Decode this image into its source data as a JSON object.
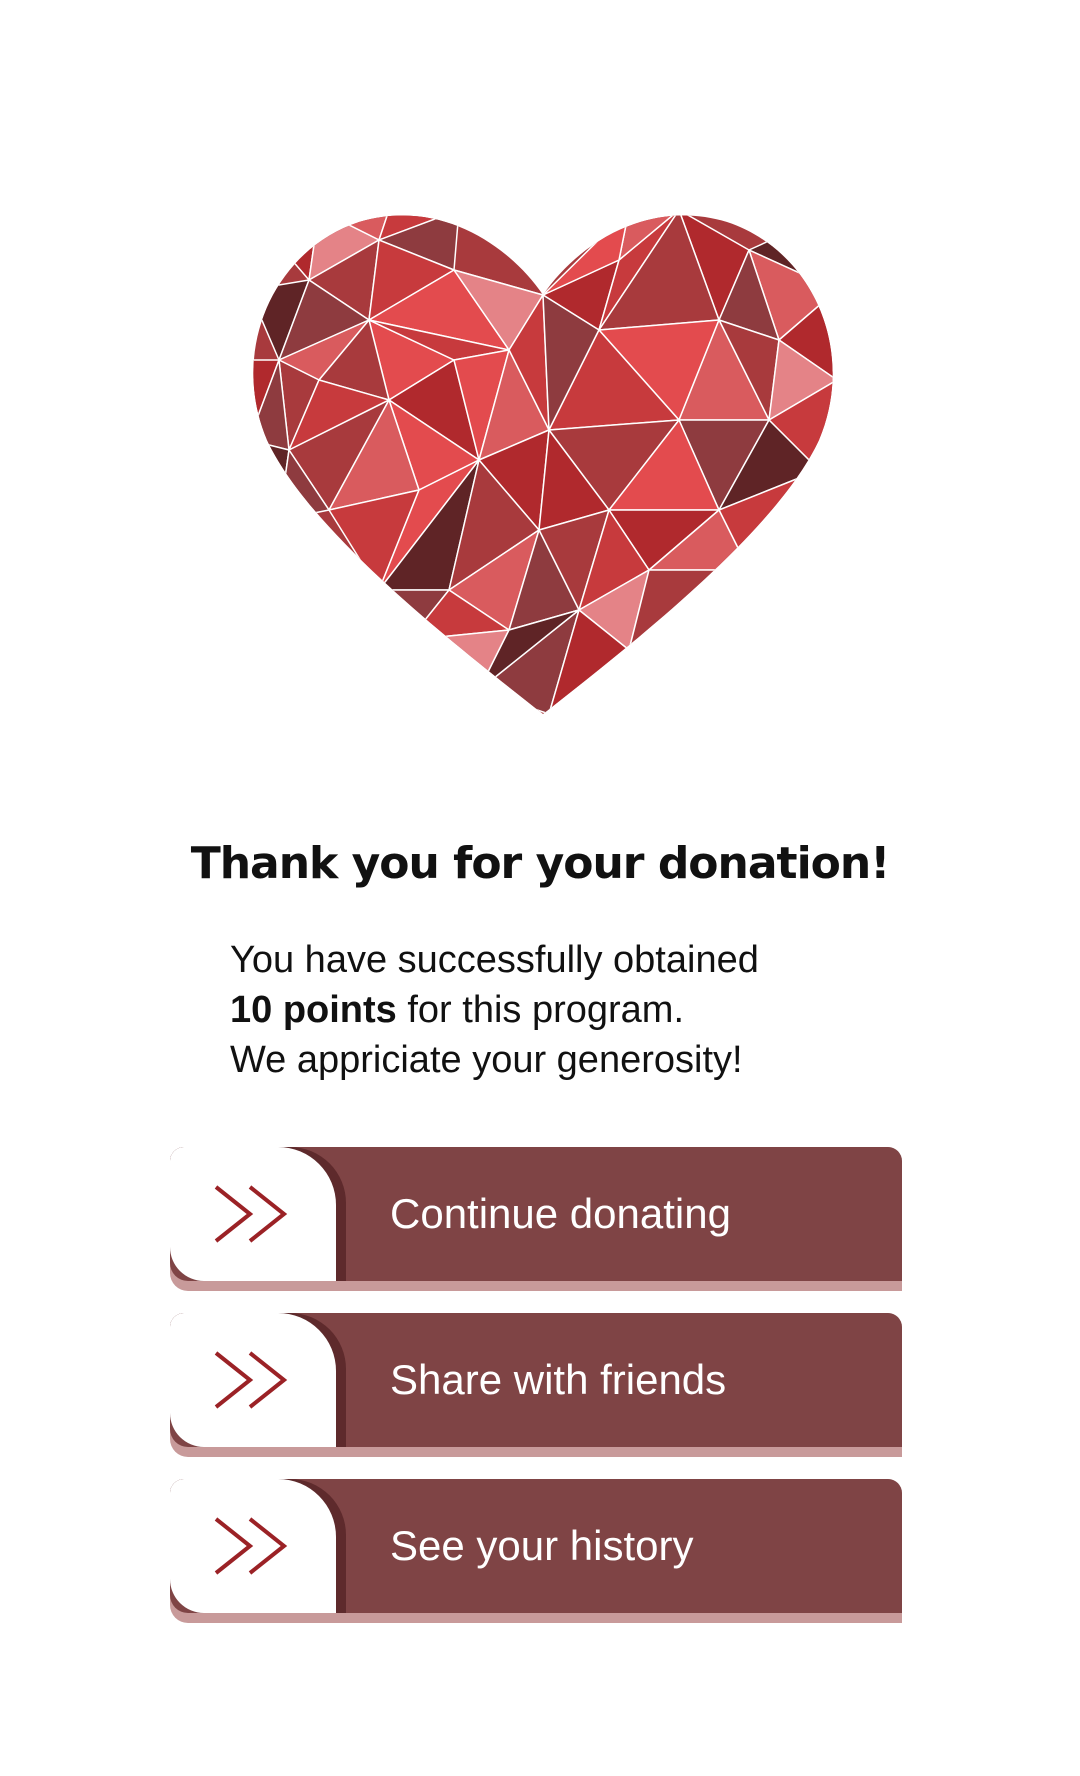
{
  "heart": {
    "icon": "polygonal-heart-icon",
    "colors": [
      "#b0292d",
      "#e34b4e",
      "#8e3b3f",
      "#d95b5e",
      "#5f2426",
      "#c73a3d",
      "#e48387"
    ]
  },
  "thanks": {
    "title": "Thank you for your donation!",
    "line1": "You have successfully obtained",
    "points_bold": "10 points",
    "line2_rest": " for this program.",
    "line3": "We appriciate your generosity!"
  },
  "actions": [
    {
      "label": "Continue donating",
      "icon": "double-chevron-right-icon"
    },
    {
      "label": "Share with friends",
      "icon": "double-chevron-right-icon"
    },
    {
      "label": "See your history",
      "icon": "double-chevron-right-icon"
    }
  ],
  "theme": {
    "button_color": "#7f4445",
    "button_underline": "#c89a9a",
    "chevron_color": "#9b2226"
  }
}
